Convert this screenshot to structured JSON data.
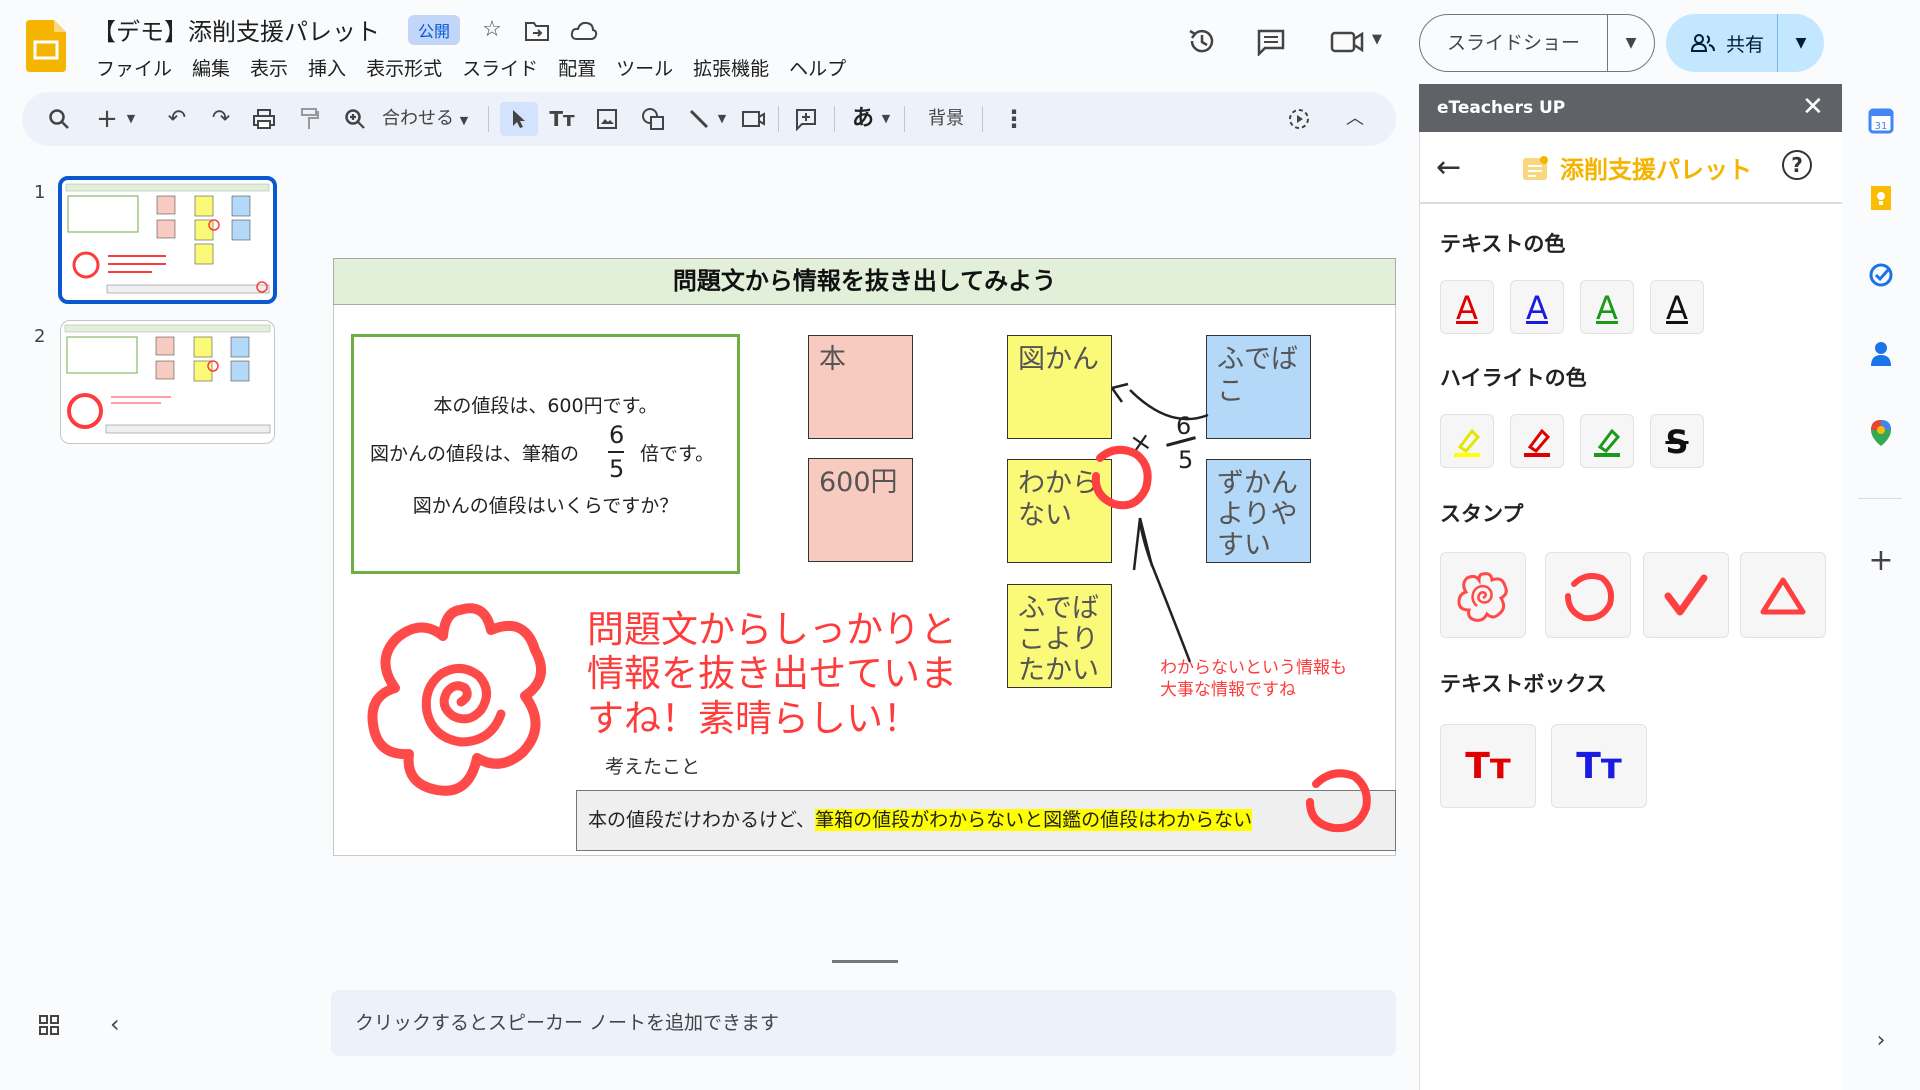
{
  "header": {
    "title": "【デモ】添削支援パレット",
    "badge": "公開",
    "menu": [
      "ファイル",
      "編集",
      "表示",
      "挿入",
      "表示形式",
      "スライド",
      "配置",
      "ツール",
      "拡張機能",
      "ヘルプ"
    ],
    "slideshow_label": "スライドショー",
    "share_label": "共有"
  },
  "toolbar": {
    "zoom_label": "合わせる",
    "background_label": "背景",
    "ime_label": "あ"
  },
  "thumbnails": [
    {
      "number": "1"
    },
    {
      "number": "2"
    }
  ],
  "slide": {
    "title": "問題文から情報を抜き出してみよう",
    "problem": {
      "line1": "本の値段は、600円です。",
      "line2a": "図かんの値段は、筆箱の",
      "frac_num": "6",
      "frac_den": "5",
      "line2b": "倍です。",
      "line3": "図かんの値段はいくらですか？"
    },
    "stickies": {
      "hon": "本",
      "yen600": "600円",
      "zukan": "図かん",
      "wakaranai": "わからない",
      "fudebako_yori_takai": "ふでばこより たかい",
      "fudebako": "ふでば こ",
      "zukan_yoriyasui": "ずかん よりや すい"
    },
    "annotation_times": "×",
    "annotation_frac_num": "6",
    "annotation_frac_den": "5",
    "comment": "問題文からしっかりと情報を抜き出せていますね！素晴らしい！",
    "small_comment_1": "わからないという情報も",
    "small_comment_2": "大事な情報ですね",
    "thought_label": "考えたこと",
    "thought_text_plain": "本の値段だけわかるけど、",
    "thought_text_highlight": "筆箱の値段がわからないと図鑑の値段はわからない"
  },
  "notes": {
    "placeholder": "クリックするとスピーカー ノートを追加できます"
  },
  "panel": {
    "app_name": "eTeachers UP",
    "title": "添削支援パレット",
    "text_color_label": "テキストの色",
    "highlight_color_label": "ハイライトの色",
    "stamp_label": "スタンプ",
    "textbox_label": "テキストボックス",
    "letter": "A",
    "textbox_glyph": "Tт",
    "text_colors": [
      "#e00000",
      "#1a1ae0",
      "#1a9a1a",
      "#111111"
    ],
    "accent": "#f4b400"
  }
}
